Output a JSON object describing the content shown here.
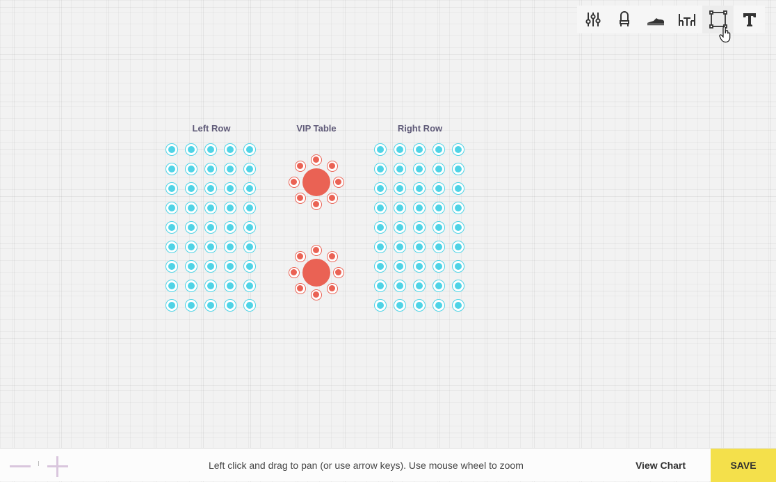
{
  "toolbar": {
    "tools": [
      {
        "icon": "sliders-icon"
      },
      {
        "icon": "chair-icon"
      },
      {
        "icon": "shoe-icon"
      },
      {
        "icon": "table-chairs-icon"
      },
      {
        "icon": "square-select-icon",
        "active": true
      },
      {
        "icon": "text-icon"
      }
    ]
  },
  "layout": {
    "sections": [
      {
        "id": "left",
        "label": "Left Row",
        "rows": 9,
        "cols": 5
      },
      {
        "id": "vip",
        "label": "VIP Table",
        "tables": 2,
        "chairs_per_table": 8
      },
      {
        "id": "right",
        "label": "Right Row",
        "rows": 9,
        "cols": 5
      }
    ]
  },
  "colors": {
    "seat": "#4fd3e6",
    "vip": "#ea6254",
    "save": "#f4e04b",
    "label": "#5f5a78"
  },
  "bottombar": {
    "hint": "Left click and drag to pan (or use arrow keys). Use mouse wheel to zoom",
    "view_chart_label": "View Chart",
    "save_label": "SAVE"
  }
}
